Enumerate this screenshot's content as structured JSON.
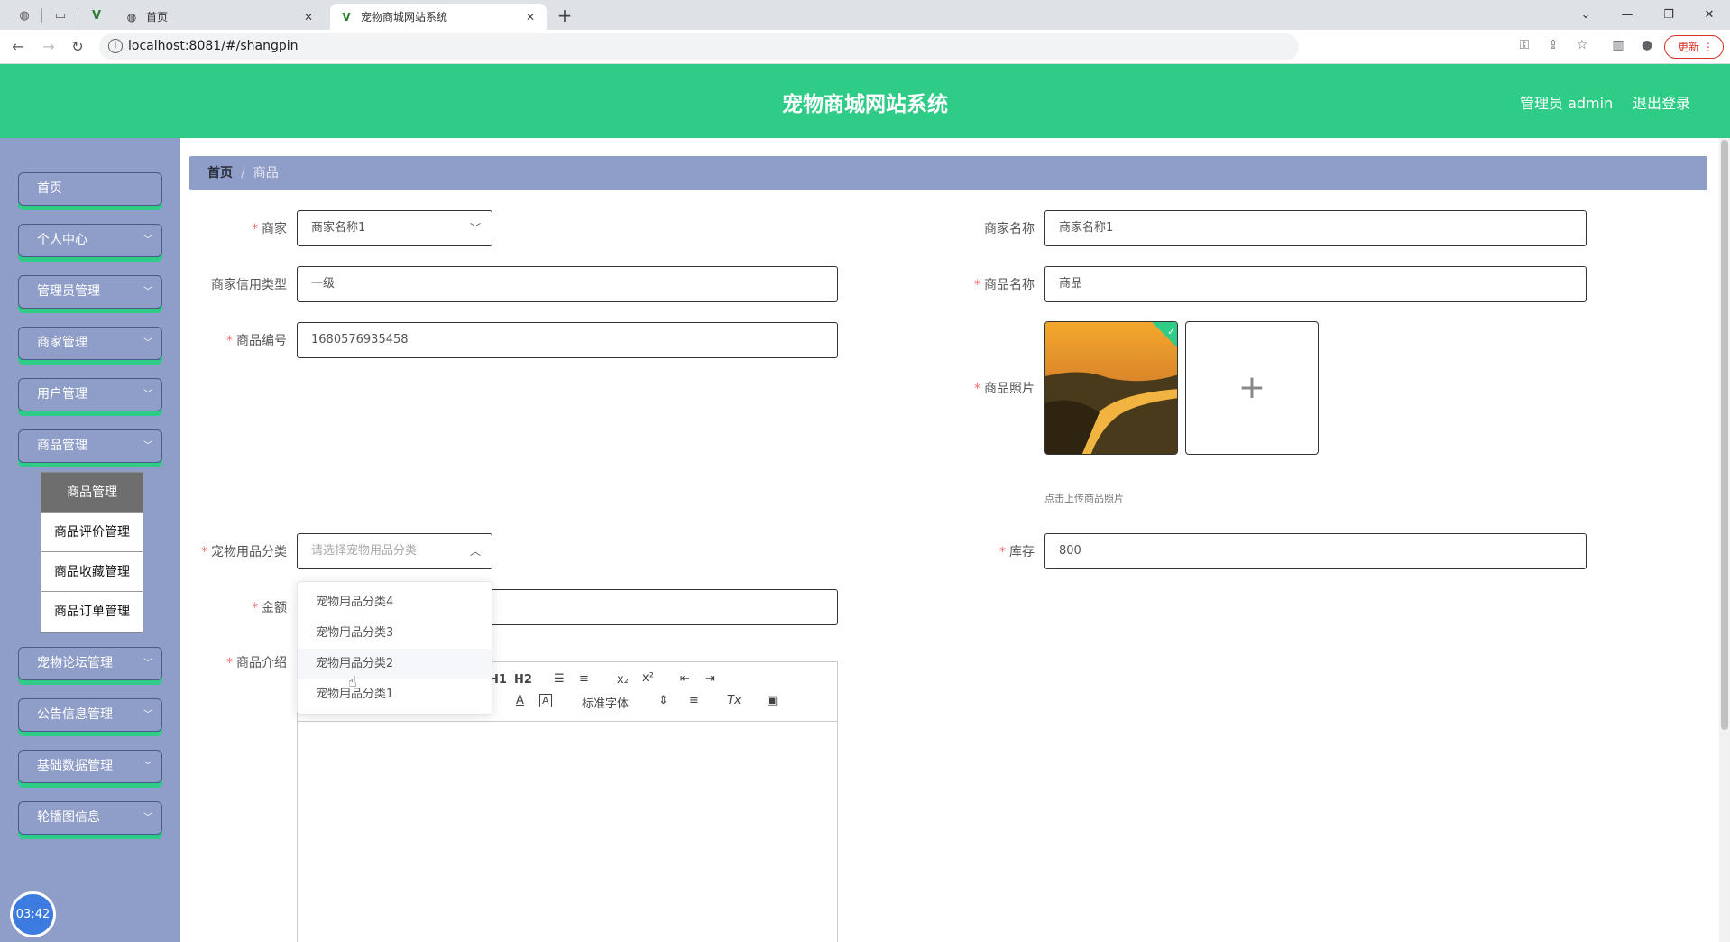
{
  "browser": {
    "tabs": [
      {
        "title": "首页",
        "active": false
      },
      {
        "title": "宠物商城网站系统",
        "active": true
      }
    ],
    "url": "localhost:8081/#/shangpin",
    "update_label": "更新"
  },
  "header": {
    "title": "宠物商城网站系统",
    "admin_label": "管理员 admin",
    "logout_label": "退出登录"
  },
  "sidebar": {
    "items": [
      {
        "label": "首页",
        "expandable": false
      },
      {
        "label": "个人中心",
        "expandable": true
      },
      {
        "label": "管理员管理",
        "expandable": true
      },
      {
        "label": "商家管理",
        "expandable": true
      },
      {
        "label": "用户管理",
        "expandable": true
      },
      {
        "label": "商品管理",
        "expandable": true
      },
      {
        "label": "宠物论坛管理",
        "expandable": true
      },
      {
        "label": "公告信息管理",
        "expandable": true
      },
      {
        "label": "基础数据管理",
        "expandable": true
      },
      {
        "label": "轮播图信息",
        "expandable": true
      }
    ],
    "submenu": [
      "商品管理",
      "商品评价管理",
      "商品收藏管理",
      "商品订单管理"
    ],
    "clock": "03:42"
  },
  "breadcrumb": {
    "home": "首页",
    "sep": "/",
    "current": "商品"
  },
  "form": {
    "merchant": {
      "label": "商家",
      "value": "商家名称1"
    },
    "merchant_name": {
      "label": "商家名称",
      "value": "商家名称1"
    },
    "credit_type": {
      "label": "商家信用类型",
      "value": "一级"
    },
    "product_name": {
      "label": "商品名称",
      "value": "商品"
    },
    "product_code": {
      "label": "商品编号",
      "value": "1680576935458"
    },
    "photo": {
      "label": "商品照片",
      "hint": "点击上传商品照片"
    },
    "category": {
      "label": "宠物用品分类",
      "placeholder": "请选择宠物用品分类"
    },
    "stock": {
      "label": "库存",
      "value": "800"
    },
    "price": {
      "label": "金额",
      "value": ""
    },
    "intro": {
      "label": "商品介绍"
    }
  },
  "dropdown": {
    "options": [
      "宠物用品分类4",
      "宠物用品分类3",
      "宠物用品分类2",
      "宠物用品分类1"
    ],
    "hovered_index": 2
  },
  "editor": {
    "font_label": "标准字体"
  }
}
